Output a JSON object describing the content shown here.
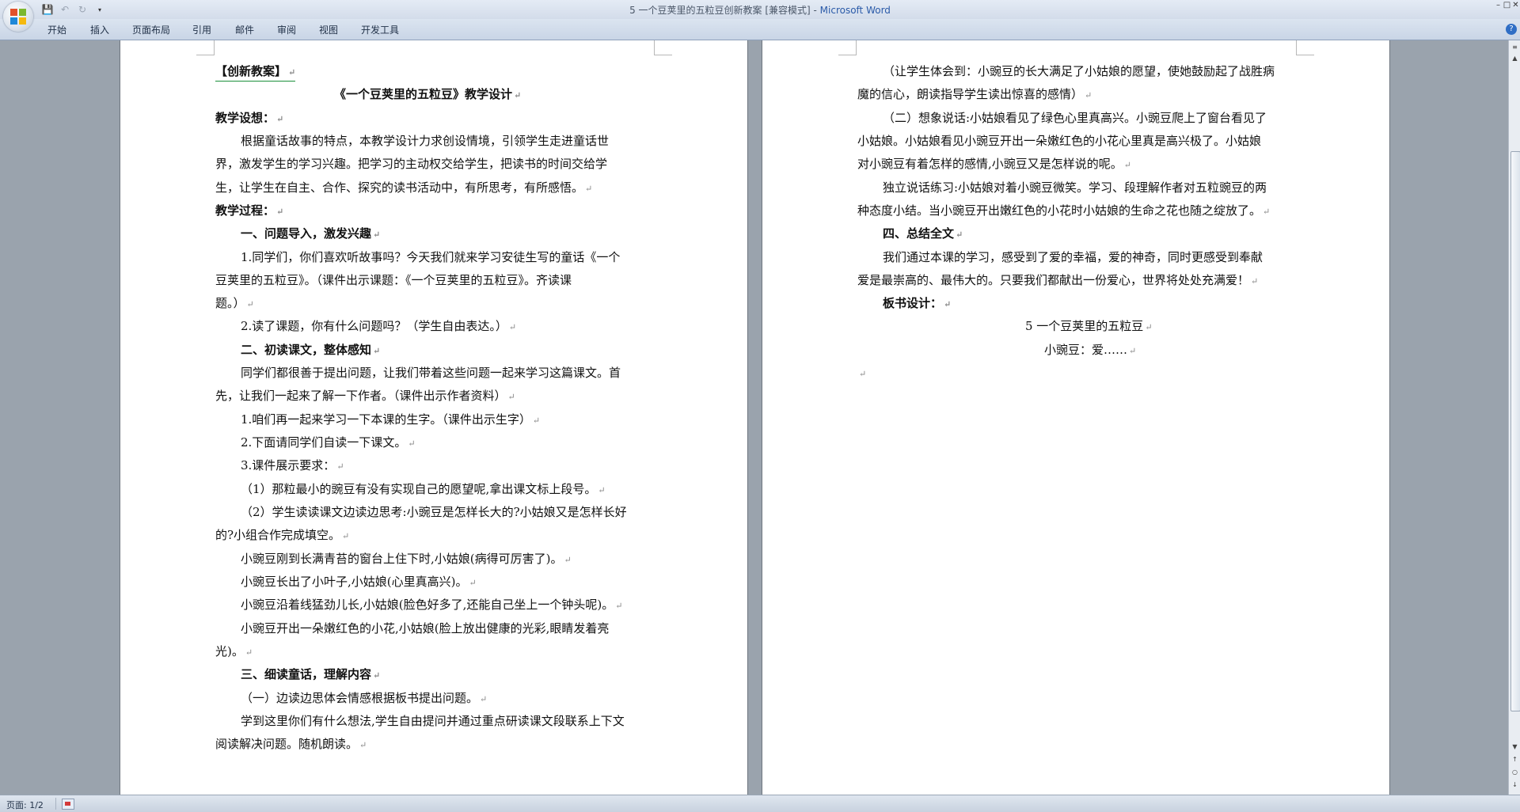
{
  "window": {
    "title": "5 一个豆荚里的五粒豆创新教案 [兼容模式] - ",
    "app_name": "Microsoft Word"
  },
  "quick_access": {
    "save_icon": "save-icon",
    "undo_icon": "undo-icon",
    "redo_icon": "redo-icon",
    "customize_icon": "dropdown-icon"
  },
  "ribbon": {
    "tabs": [
      "开始",
      "插入",
      "页面布局",
      "引用",
      "邮件",
      "审阅",
      "视图",
      "开发工具"
    ]
  },
  "page1": {
    "lines": [
      "【创新教案】",
      "《一个豆荚里的五粒豆》教学设计",
      "教学设想：",
      "根据童话故事的特点，本教学设计力求创设情境，引领学生走进童话世",
      "界，激发学生的学习兴趣。把学习的主动权交给学生，把读书的时间交给学",
      "生，让学生在自主、合作、探究的读书活动中，有所思考，有所感悟。",
      "教学过程：",
      "一、问题导入，激发兴趣",
      "1.同学们，你们喜欢听故事吗？今天我们就来学习安徒生写的童话《一个",
      "豆荚里的五粒豆》。（课件出示课题：《一个豆荚里的五粒豆》。齐读课",
      "题。）",
      "2.读了课题，你有什么问题吗？（学生自由表达。）",
      "二、初读课文，整体感知",
      "同学们都很善于提出问题，让我们带着这些问题一起来学习这篇课文。首",
      "先，让我们一起来了解一下作者。（课件出示作者资料）",
      "1.咱们再一起来学习一下本课的生字。（课件出示生字）",
      "2.下面请同学们自读一下课文。",
      "3.课件展示要求：",
      "（1）那粒最小的豌豆有没有实现自己的愿望呢,拿出课文标上段号。",
      "（2）学生读读课文边读边思考:小豌豆是怎样长大的?小姑娘又是怎样长好",
      "的?小组合作完成填空。",
      "小豌豆刚到长满青苔的窗台上住下时,小姑娘(病得可厉害了)。",
      "小豌豆长出了小叶子,小姑娘(心里真高兴)。",
      "小豌豆沿着线猛劲儿长,小姑娘(脸色好多了,还能自己坐上一个钟头呢)。",
      "小豌豆开出一朵嫩红色的小花,小姑娘(脸上放出健康的光彩,眼睛发着亮",
      "光)。",
      "三、细读童话，理解内容",
      "（一）边读边思体会情感根据板书提出问题。",
      "学到这里你们有什么想法,学生自由提问并通过重点研读课文段联系上下文",
      "阅读解决问题。随机朗读。"
    ]
  },
  "page2": {
    "lines": [
      "（让学生体会到：小豌豆的长大满足了小姑娘的愿望，使她鼓励起了战胜病",
      "魔的信心，朗读指导学生读出惊喜的感情）",
      "（二）想象说话:小姑娘看见了绿色心里真高兴。小豌豆爬上了窗台看见了",
      "小姑娘。小姑娘看见小豌豆开出一朵嫩红色的小花心里真是高兴极了。小姑娘",
      "对小豌豆有着怎样的感情,小豌豆又是怎样说的呢。",
      "独立说话练习:小姑娘对着小豌豆微笑。学习、段理解作者对五粒豌豆的两",
      "种态度小结。当小豌豆开出嫩红色的小花时小姑娘的生命之花也随之绽放了。",
      "四、总结全文",
      "我们通过本课的学习，感受到了爱的幸福，爱的神奇，同时更感受到奉献",
      "爱是最崇高的、最伟大的。只要我们都献出一份爱心，世界将处处充满爱！",
      "板书设计：",
      "5 一个豆荚里的五粒豆",
      "小豌豆：爱……"
    ]
  },
  "status": {
    "page_indicator": "页面: 1/2"
  },
  "colors": {
    "link_underline": "#1a8f3a",
    "app_title": "#2a5aa8"
  }
}
